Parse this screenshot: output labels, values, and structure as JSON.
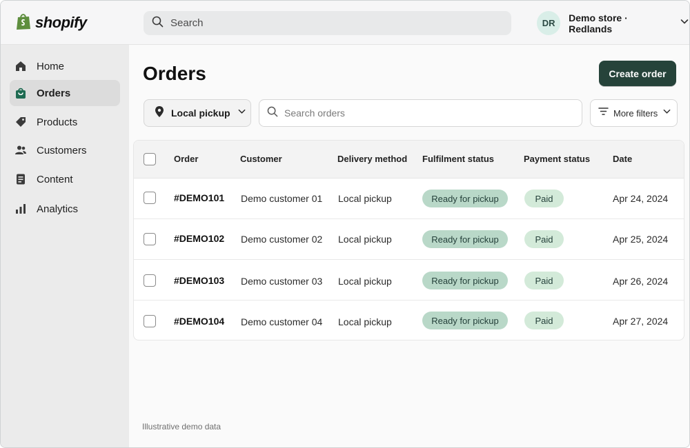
{
  "topbar": {
    "logo_text": "shopify",
    "search_placeholder": "Search",
    "store": {
      "initials": "DR",
      "name": "Demo store · Redlands"
    }
  },
  "sidebar": {
    "items": [
      {
        "label": "Home",
        "icon": "home-icon",
        "active": false
      },
      {
        "label": "Orders",
        "icon": "shopping-bag-icon",
        "active": true
      },
      {
        "label": "Products",
        "icon": "tag-icon",
        "active": false
      },
      {
        "label": "Customers",
        "icon": "people-icon",
        "active": false
      },
      {
        "label": "Content",
        "icon": "document-icon",
        "active": false
      },
      {
        "label": "Analytics",
        "icon": "bar-chart-icon",
        "active": false
      }
    ]
  },
  "main": {
    "title": "Orders",
    "create_button": "Create order",
    "filter": {
      "label": "Local pickup",
      "icon": "location-pin-icon"
    },
    "order_search_placeholder": "Search orders",
    "more_filters": "More filters"
  },
  "table": {
    "headers": [
      "Order",
      "Customer",
      "Delivery method",
      "Fulfilment status",
      "Payment status",
      "Date"
    ],
    "rows": [
      {
        "order": "#DEMO101",
        "customer": "Demo customer 01",
        "delivery": "Local pickup",
        "fulfilment": "Ready for pickup",
        "payment": "Paid",
        "date": "Apr 24, 2024"
      },
      {
        "order": "#DEMO102",
        "customer": "Demo customer 02",
        "delivery": "Local pickup",
        "fulfilment": "Ready for pickup",
        "payment": "Paid",
        "date": "Apr 25, 2024"
      },
      {
        "order": "#DEMO103",
        "customer": "Demo customer 03",
        "delivery": "Local pickup",
        "fulfilment": "Ready for pickup",
        "payment": "Paid",
        "date": "Apr 26, 2024"
      },
      {
        "order": "#DEMO104",
        "customer": "Demo customer 04",
        "delivery": "Local pickup",
        "fulfilment": "Ready for pickup",
        "payment": "Paid",
        "date": "Apr 27, 2024"
      }
    ]
  },
  "footnote": "Illustrative demo data",
  "colors": {
    "primary_button": "#26433a",
    "fulfilment_badge": "#b9d8c8",
    "paid_badge": "#d3ead9",
    "brand_green": "#5e8e3e"
  }
}
